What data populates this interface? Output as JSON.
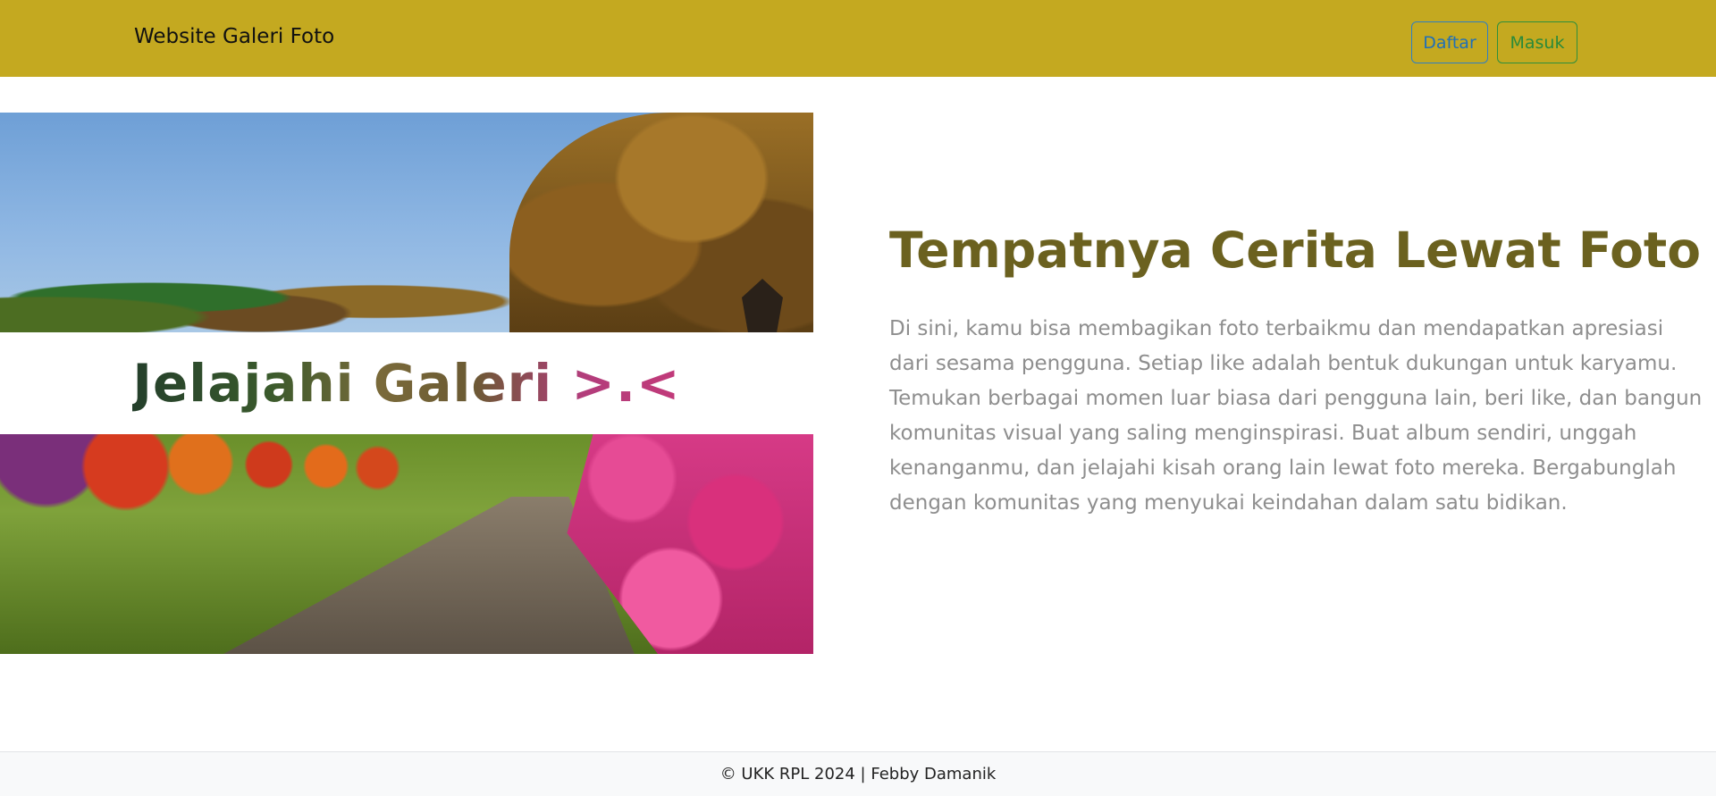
{
  "navbar": {
    "brand": "Website Galeri Foto",
    "buttons": {
      "daftar": "Daftar",
      "masuk": "Masuk"
    },
    "background_color": "#c4a920"
  },
  "hero": {
    "image_caption": "Jelajahi Galeri >.<",
    "title": "Tempatnya Cerita Lewat Foto",
    "description": "Di sini, kamu bisa membagikan foto terbaikmu dan mendapatkan apresiasi dari sesama pengguna. Setiap like adalah bentuk dukungan untuk karyamu. Temukan berbagai momen luar biasa dari pengguna lain, beri like, dan bangun komunitas visual yang saling menginspirasi. Buat album sendiri, unggah kenanganmu, dan jelajahi kisah orang lain lewat foto mereka. Bergabunglah dengan komunitas yang menyukai keindahan dalam satu bidikan.",
    "title_color": "#6b611f"
  },
  "footer": {
    "text": "© UKK RPL 2024 | Febby Damanik"
  }
}
